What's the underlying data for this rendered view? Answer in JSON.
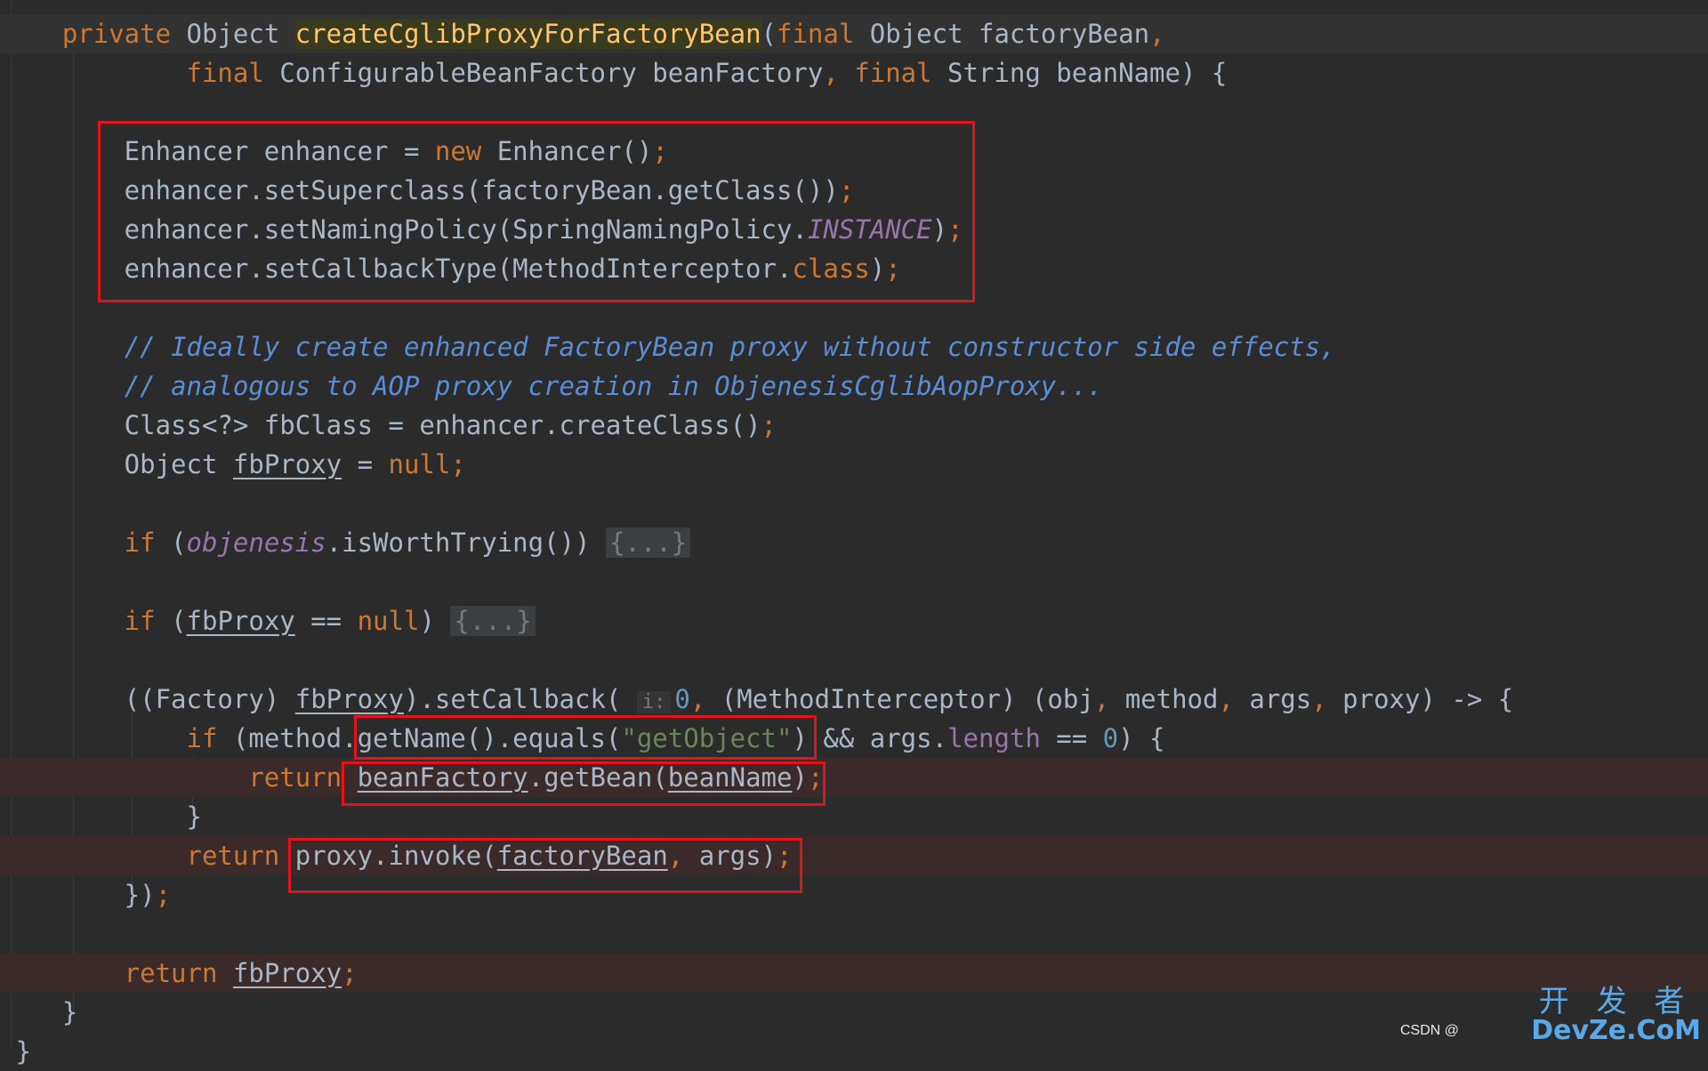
{
  "editor": {
    "lines": [
      {
        "id": "l1",
        "tokens": [
          {
            "t": "    private",
            "c": "kw"
          },
          {
            "t": " Object "
          },
          {
            "t": "createCglibProxyForFactoryBean",
            "c": "hl"
          },
          {
            "t": "("
          },
          {
            "t": "final",
            "c": "kw"
          },
          {
            "t": " Object factoryBean"
          },
          {
            "t": ",",
            "c": "kw"
          }
        ]
      },
      {
        "id": "l2",
        "tokens": [
          {
            "t": "            final",
            "c": "kw"
          },
          {
            "t": " ConfigurableBeanFactory beanFactory"
          },
          {
            "t": ", ",
            "c": "kw"
          },
          {
            "t": "final",
            "c": "kw"
          },
          {
            "t": " String beanName) {"
          }
        ]
      },
      {
        "id": "l3",
        "tokens": []
      },
      {
        "id": "l4",
        "tokens": [
          {
            "t": "        Enhancer enhancer = "
          },
          {
            "t": "new",
            "c": "kw"
          },
          {
            "t": " Enhancer()"
          },
          {
            "t": ";",
            "c": "kw"
          }
        ]
      },
      {
        "id": "l5",
        "tokens": [
          {
            "t": "        enhancer.setSuperclass(factoryBean.getClass())"
          },
          {
            "t": ";",
            "c": "kw"
          }
        ]
      },
      {
        "id": "l6",
        "tokens": [
          {
            "t": "        enhancer.setNamingPolicy(SpringNamingPolicy."
          },
          {
            "t": "INSTANCE",
            "c": "fld"
          },
          {
            "t": ")"
          },
          {
            "t": ";",
            "c": "kw"
          }
        ]
      },
      {
        "id": "l7",
        "tokens": [
          {
            "t": "        enhancer.setCallbackType(MethodInterceptor."
          },
          {
            "t": "class",
            "c": "kw"
          },
          {
            "t": ")"
          },
          {
            "t": ";",
            "c": "kw"
          }
        ]
      },
      {
        "id": "l8",
        "tokens": []
      },
      {
        "id": "l9",
        "tokens": [
          {
            "t": "        "
          },
          {
            "t": "// Ideally create enhanced FactoryBean proxy without constructor side effects,",
            "c": "cmt"
          }
        ]
      },
      {
        "id": "l10",
        "tokens": [
          {
            "t": "        "
          },
          {
            "t": "// analogous to AOP proxy creation in ObjenesisCglibAopProxy...",
            "c": "cmt"
          }
        ]
      },
      {
        "id": "l11",
        "tokens": [
          {
            "t": "        Class<?> fbClass = enhancer.createClass()"
          },
          {
            "t": ";",
            "c": "kw"
          }
        ]
      },
      {
        "id": "l12",
        "tokens": [
          {
            "t": "        Object "
          },
          {
            "t": "fbProxy",
            "c": "ul"
          },
          {
            "t": " = "
          },
          {
            "t": "null",
            "c": "kw"
          },
          {
            "t": ";",
            "c": "kw"
          }
        ]
      },
      {
        "id": "l13",
        "tokens": []
      },
      {
        "id": "l14",
        "tokens": [
          {
            "t": "        if",
            "c": "kw"
          },
          {
            "t": " ("
          },
          {
            "t": "objenesis",
            "c": "fld"
          },
          {
            "t": ".isWorthTrying()) "
          },
          {
            "t": "{...}",
            "c": "fold"
          }
        ]
      },
      {
        "id": "l15",
        "tokens": []
      },
      {
        "id": "l16",
        "tokens": [
          {
            "t": "        if",
            "c": "kw"
          },
          {
            "t": " ("
          },
          {
            "t": "fbProxy",
            "c": "ul"
          },
          {
            "t": " == "
          },
          {
            "t": "null",
            "c": "kw"
          },
          {
            "t": ") "
          },
          {
            "t": "{...}",
            "c": "fold"
          }
        ]
      },
      {
        "id": "l17",
        "tokens": []
      },
      {
        "id": "l18",
        "tokens": [
          {
            "t": "        ((Factory) "
          },
          {
            "t": "fbProxy",
            "c": "ul"
          },
          {
            "t": ").setCallback( "
          },
          {
            "t": "i:",
            "c": "hint"
          },
          {
            "t": "0",
            "c": "num"
          },
          {
            "t": ", ",
            "c": "kw"
          },
          {
            "t": "(MethodInterceptor) (obj"
          },
          {
            "t": ", ",
            "c": "kw"
          },
          {
            "t": "method"
          },
          {
            "t": ", ",
            "c": "kw"
          },
          {
            "t": "args"
          },
          {
            "t": ", ",
            "c": "kw"
          },
          {
            "t": "proxy) -> {"
          }
        ]
      },
      {
        "id": "l19",
        "tokens": [
          {
            "t": "            if",
            "c": "kw"
          },
          {
            "t": " (method.getName().equals("
          },
          {
            "t": "\"getObject\"",
            "c": "str"
          },
          {
            "t": ") && args."
          },
          {
            "t": "length",
            "c": "prop"
          },
          {
            "t": " == "
          },
          {
            "t": "0",
            "c": "num"
          },
          {
            "t": ") {"
          }
        ]
      },
      {
        "id": "l20",
        "bp": true,
        "tokens": [
          {
            "t": "                return",
            "c": "kw"
          },
          {
            "t": " "
          },
          {
            "t": "beanFactory",
            "c": "ul"
          },
          {
            "t": ".getBean("
          },
          {
            "t": "beanName",
            "c": "ul"
          },
          {
            "t": ")"
          },
          {
            "t": ";",
            "c": "kw"
          }
        ]
      },
      {
        "id": "l21",
        "tokens": [
          {
            "t": "            }"
          }
        ]
      },
      {
        "id": "l22",
        "bp": true,
        "tokens": [
          {
            "t": "            return",
            "c": "kw"
          },
          {
            "t": " proxy.invoke("
          },
          {
            "t": "factoryBean",
            "c": "ul"
          },
          {
            "t": ", ",
            "c": "kw"
          },
          {
            "t": "args)"
          },
          {
            "t": ";",
            "c": "kw"
          }
        ]
      },
      {
        "id": "l23",
        "tokens": [
          {
            "t": "        })"
          },
          {
            "t": ";",
            "c": "kw"
          }
        ]
      },
      {
        "id": "l24",
        "tokens": []
      },
      {
        "id": "l25",
        "bp": true,
        "tokens": [
          {
            "t": "        return",
            "c": "kw"
          },
          {
            "t": " "
          },
          {
            "t": "fbProxy",
            "c": "ul"
          },
          {
            "t": ";",
            "c": "kw"
          }
        ]
      },
      {
        "id": "l26",
        "tokens": [
          {
            "t": "    }"
          }
        ]
      },
      {
        "id": "l27",
        "tokens": [
          {
            "t": " }"
          }
        ]
      }
    ]
  },
  "watermark": {
    "csdn": "CSDN @",
    "logo_cn": "开 发 者",
    "logo_en": "DevZe.CoM"
  },
  "colors": {
    "background": "#2b2b2b",
    "keyword": "#cc7832",
    "string": "#6a8759",
    "number": "#6897bb",
    "comment": "#5b8dd6",
    "field": "#9876aa",
    "highlight_box": "#e0141e"
  }
}
